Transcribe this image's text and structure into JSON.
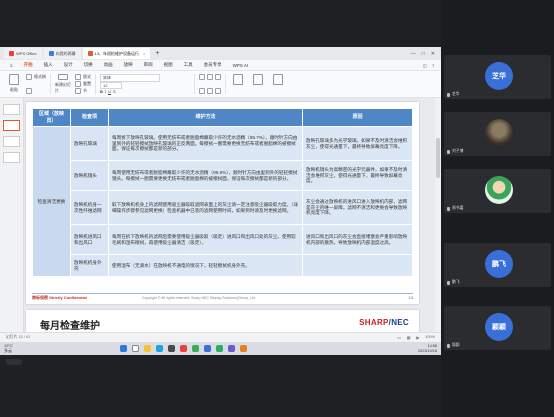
{
  "file_tabs": [
    {
      "label": "WPS Office",
      "color": "#e94040",
      "active": false
    },
    {
      "label": "向我的两幕",
      "color": "#3b7be8",
      "active": false
    },
    {
      "label": "13、年巡检维护设备运行",
      "color": "#e35d2b",
      "active": true
    },
    {
      "label": "+",
      "color": "",
      "active": false
    }
  ],
  "ribbon_tabs": [
    "开始",
    "插入",
    "设计",
    "切换",
    "动画",
    "放映",
    "审阅",
    "视图",
    "工具",
    "会员专享",
    "WPS AI"
  ],
  "ribbon_active": "开始",
  "ribbon": {
    "paste": "粘贴",
    "format_painter": "格式刷",
    "new_slide": "新建幻灯片",
    "layout": "版式",
    "reset": "重置",
    "section": "节",
    "font_box": "宋体",
    "font_size": "12"
  },
  "table": {
    "headers": [
      "区域（放映员）",
      "检查项",
      "维护方法",
      "原因"
    ],
    "area_label": "检查清洁更换",
    "rows": [
      {
        "item": "放映孔玻璃",
        "method": "每周拆下放映孔玻璃。使用无纺布或者脱脂棉蘸取少许的无水酒精（99.7%），顺时针方向由里到外的轻轻擦拭放映孔玻璃的正反两面。每擦拭一圈需要更换无纺布或者脱脂棉的被擦拭面，保证每次擦拭都是新的部分。",
        "reason": "放映孔玻璃多为光学玻璃，如果不及时清洁会堆积灰尘，使得光通量下，最终导致屏幕亮度下降。"
      },
      {
        "item": "放映机镜头",
        "method": "每周使用无纺布或者脱脂棉蘸取少许的无水酒精（99.8%），顺时针方向由里到外的轻轻擦拭镜头。每擦拭一圈需要更换无纺布或者脱脂棉的被擦拭面，保证每次擦拭都是新的部分。",
        "reason": "放映机镜头为高精密的光学元器件，如果不及时清洁会堆积灰尘，使得光通量下，最终导致屏幕亮度。"
      },
      {
        "item": "放映机机身一次性纤维滤网",
        "method": "取下放映机机身上的滤网使用吸尘器吸取滤网表面上的灰尘请一定注意吸尘器吸取力度。（详细操作步骤参见滤网更换）检查机器中已装的滤网使用时间，如果到时请及时更换滤网。",
        "reason": "灰尘会通过放映机的进风口进入放映机内部，滤网是灰尘的唯一屏障，滤网不清洁和更换会导致放映机亮度下降。"
      },
      {
        "item": "放映机进风口和出风口",
        "method": "每周在拆下放映机的滤网后需要使用吸尘器吸取（吸走）进风口和出风口处的灰尘。使用软毛刷和湿布擦拭，再使用吸尘器清洁（吸走）。",
        "reason": "进风口和出风口的灰尘会直接堵塞会严重影响放映机内部的散热，导致放映机内部温度过高。"
      },
      {
        "item": "放映机机身外壳",
        "method": "使用湿布（无滴水）在放映机不通电的情况下，轻轻擦拭机身外壳。",
        "reason": ""
      }
    ]
  },
  "slide": {
    "confidential": "商标保密 Strictly Confidential",
    "copyright": "Copyright © All rights reserved. Sharp NEC Display Solutions(China), Ltd.",
    "page": "13"
  },
  "next_slide": {
    "title": "每月检查维护",
    "logo_a": "SHARP",
    "logo_b": "NEC"
  },
  "statusbar": {
    "left": "幻灯片 13 / 41",
    "zoom": "100%"
  },
  "taskbar": {
    "temp": "19°C",
    "weather": "多云",
    "time": "14:58",
    "date": "2023/10/16"
  },
  "participants": [
    {
      "name": "芝华",
      "label": "芝华",
      "type": "avatar",
      "color": "#3a6fd8"
    },
    {
      "name": "刘子博",
      "label": "",
      "type": "photo-dark",
      "color": "#5a4a3a"
    },
    {
      "name": "周书嘉",
      "label": "",
      "type": "photo-green",
      "color": "#35a05a"
    },
    {
      "name": "鹏飞",
      "label": "鹏飞",
      "type": "avatar",
      "color": "#3a6fd8"
    },
    {
      "name": "颖颖",
      "label": "颖颖",
      "type": "avatar",
      "color": "#3a6fd8"
    }
  ]
}
